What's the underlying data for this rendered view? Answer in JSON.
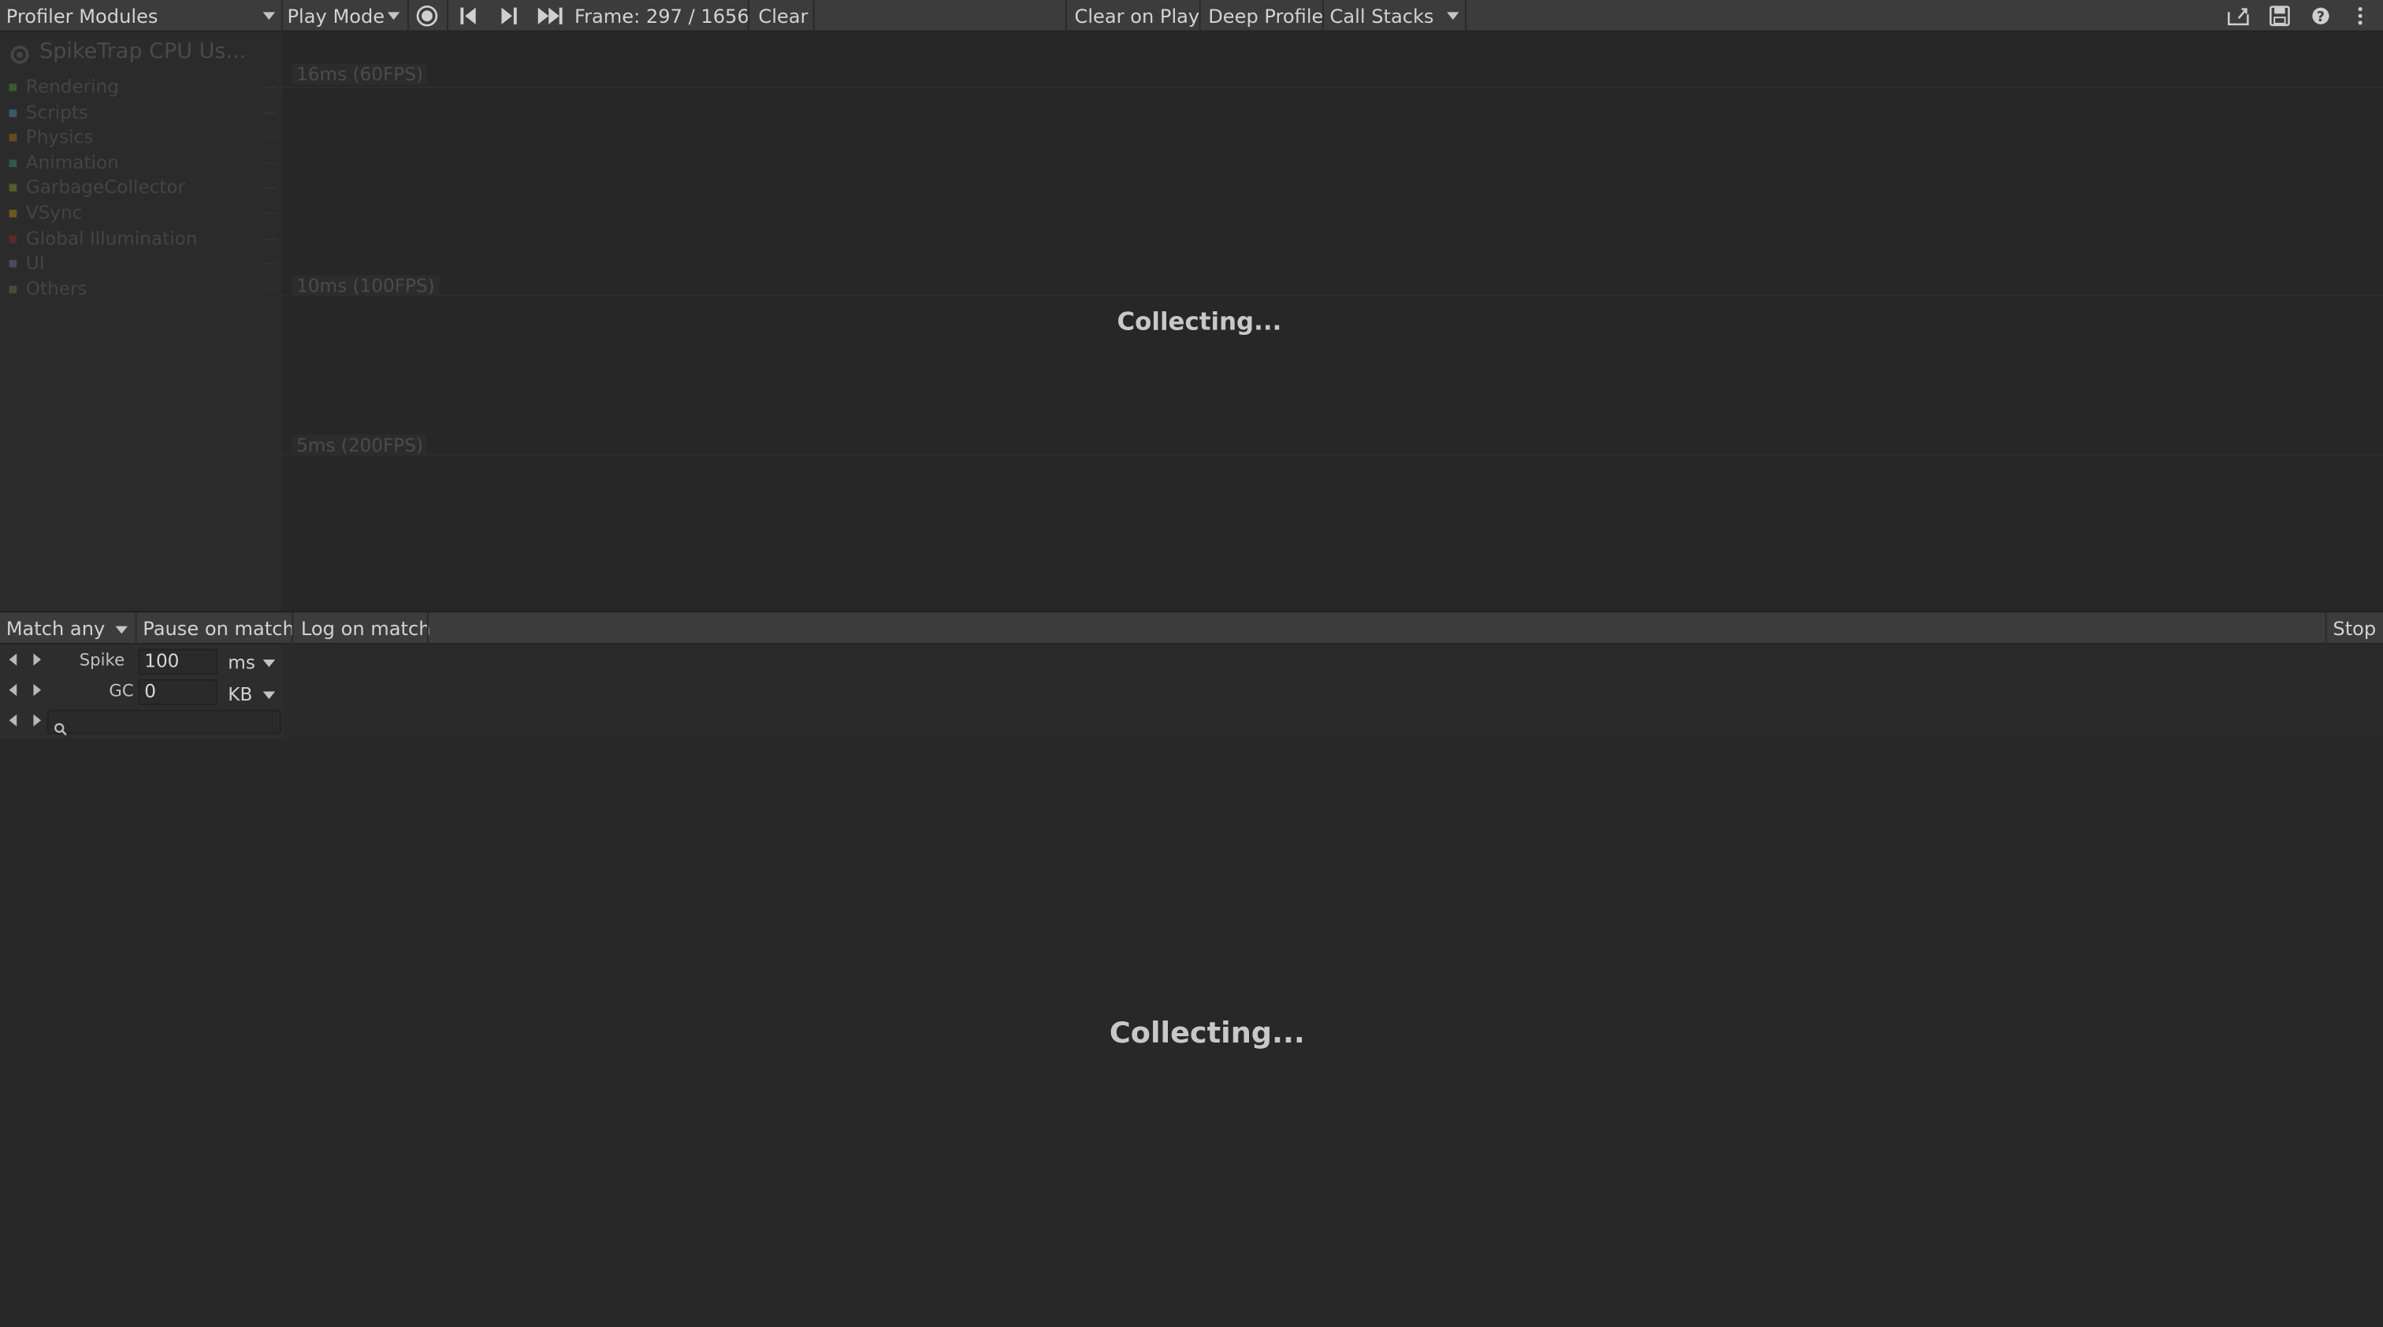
{
  "toolbar": {
    "profiler_modules": "Profiler Modules",
    "play_mode": "Play Mode",
    "frame": "Frame: 297 / 1656",
    "clear": "Clear",
    "clear_on_play": "Clear on Play",
    "deep_profile": "Deep Profile",
    "call_stacks": "Call Stacks",
    "icons": [
      "record-icon",
      "step-back-icon",
      "step-forward-icon",
      "skip-to-end-icon",
      "load-icon",
      "save-icon",
      "help-icon",
      "more-options-icon"
    ]
  },
  "legend": {
    "title": "SpikeTrap CPU Us...",
    "items": [
      {
        "label": "Rendering",
        "color": "#3a5a2a"
      },
      {
        "label": "Scripts",
        "color": "#3a5a68"
      },
      {
        "label": "Physics",
        "color": "#6a4a1a"
      },
      {
        "label": "Animation",
        "color": "#2e5a4a"
      },
      {
        "label": "GarbageCollector",
        "color": "#5a5a26"
      },
      {
        "label": "VSync",
        "color": "#6a5a20"
      },
      {
        "label": "Global Illumination",
        "color": "#5a2a2a"
      },
      {
        "label": "UI",
        "color": "#4a4a5a"
      },
      {
        "label": "Others",
        "color": "#4a4a3a"
      }
    ]
  },
  "chart": {
    "grid": [
      "16ms (60FPS)",
      "10ms (100FPS)",
      "5ms (200FPS)"
    ],
    "status": "Collecting..."
  },
  "filterbar": {
    "match": "Match any",
    "pause": "Pause on match",
    "log": "Log on match",
    "stop": "Stop"
  },
  "filters": {
    "spike_label": "Spike",
    "spike_value": "100",
    "spike_unit": "ms",
    "gc_label": "GC",
    "gc_value": "0",
    "gc_unit": "KB",
    "search_placeholder": ""
  },
  "details": {
    "status": "Collecting..."
  }
}
